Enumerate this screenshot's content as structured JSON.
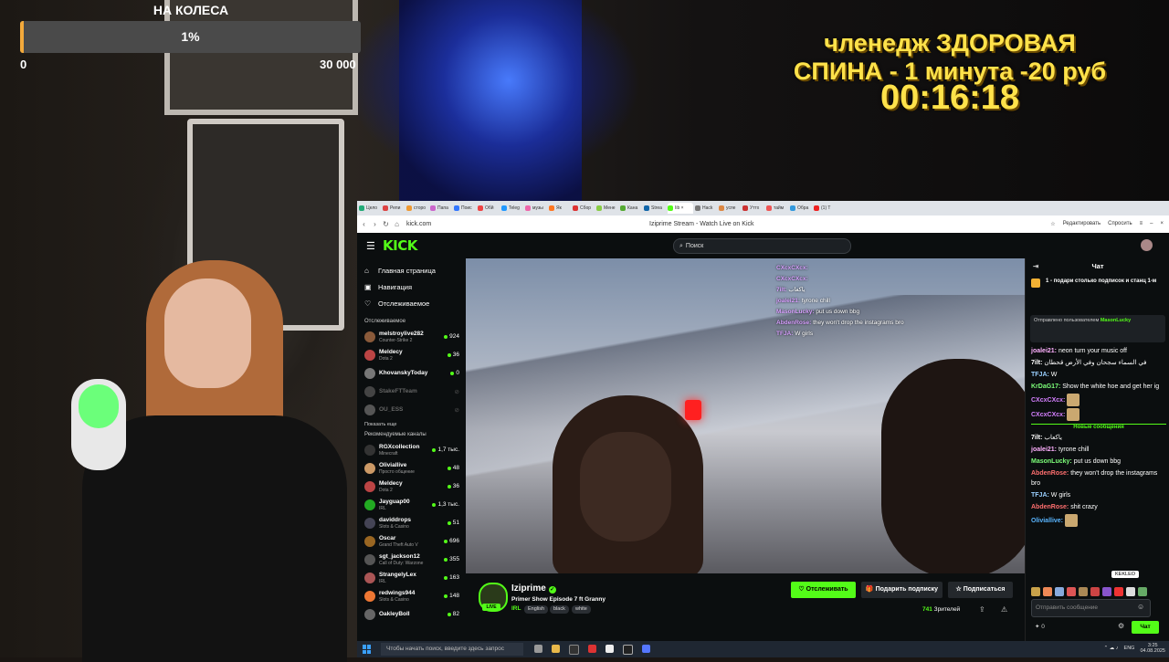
{
  "overlay": {
    "goal_title": "НА КОЛЕСА",
    "goal_percent": "1%",
    "goal_fraction": 0.01,
    "goal_min": "0",
    "goal_max": "30 000",
    "challenge_line1": "членедж ЗДОРОВАЯ",
    "challenge_line2": "СПИНА - 1 минута -20 руб",
    "timer": "00:16:18"
  },
  "browser": {
    "tabs": [
      "Цело",
      "Репи",
      "сторо",
      "Папа",
      "Поис",
      "Обй",
      "Teleg",
      "музы",
      "Як",
      "Сбор",
      "Мене",
      "Кана",
      "Strea",
      "Iib ×",
      "Hack",
      "успе",
      "Уттх",
      "тайм",
      "Обра",
      "(1) T"
    ],
    "active_tab_index": 13,
    "url": "kick.com",
    "page_title": "Iziprime Stream - Watch Live on Kick",
    "right_actions": [
      "Редактировать",
      "Спросить"
    ]
  },
  "kick": {
    "logo": "KICK",
    "search_placeholder": "Поиск",
    "nav": [
      {
        "label": "Главная страница",
        "icon": "home-icon",
        "glyph": "⌂"
      },
      {
        "label": "Навигация",
        "icon": "compass-icon",
        "glyph": "▣"
      },
      {
        "label": "Отслеживаемое",
        "icon": "heart-icon",
        "glyph": "♡"
      }
    ],
    "followed_title": "Отслеживаемое",
    "followed": [
      {
        "name": "melstroylive282",
        "game": "Counter-Strike 2",
        "viewers": "924",
        "online": true,
        "color": "#8a5a3a"
      },
      {
        "name": "Meldecy",
        "game": "Dota 2",
        "viewers": "36",
        "online": true,
        "color": "#b44"
      },
      {
        "name": "KhovanskyToday",
        "game": "",
        "viewers": "0",
        "online": true,
        "color": "#777"
      },
      {
        "name": "StakeFTTeam",
        "game": "",
        "viewers": "",
        "online": false,
        "color": "#444"
      },
      {
        "name": "OU_ESS",
        "game": "",
        "viewers": "",
        "online": false,
        "color": "#555"
      }
    ],
    "show_more": "Показать еще",
    "recommended_title": "Рекомендуемые каналы",
    "recommended": [
      {
        "name": "RGXcollection",
        "game": "Minecraft",
        "viewers": "1,7 тыс.",
        "color": "#333"
      },
      {
        "name": "Oliviallive",
        "game": "Просто общение",
        "viewers": "48",
        "color": "#c96"
      },
      {
        "name": "Meldecy",
        "game": "Dota 2",
        "viewers": "36",
        "color": "#b44"
      },
      {
        "name": "Jayguap00",
        "game": "IRL",
        "viewers": "1,3 тыс.",
        "color": "#2a2"
      },
      {
        "name": "daviddrops",
        "game": "Slots & Casino",
        "viewers": "51",
        "color": "#445"
      },
      {
        "name": "Oscar",
        "game": "Grand Theft Auto V",
        "viewers": "696",
        "color": "#962"
      },
      {
        "name": "sgt_jackson12",
        "game": "Call of Duty: Warzone",
        "viewers": "355",
        "color": "#555"
      },
      {
        "name": "StrangelyLex",
        "game": "IRL",
        "viewers": "163",
        "color": "#a55"
      },
      {
        "name": "redwings944",
        "game": "Slots & Casino",
        "viewers": "148",
        "color": "#e73"
      },
      {
        "name": "OakleyBoll",
        "game": "",
        "viewers": "82",
        "color": "#666"
      }
    ],
    "video_overlay_chat": [
      {
        "user": "CXcxCXcx:",
        "text": ""
      },
      {
        "user": "CXcxCXcx:",
        "text": ""
      },
      {
        "user": "7ilt:",
        "text": "ياكعاب"
      },
      {
        "user": "joalei21:",
        "text": "tyrone chill"
      },
      {
        "user": "MasonLucky:",
        "text": "put us down bbg"
      },
      {
        "user": "AbdenRose:",
        "text": "they won't drop the instagrams bro"
      },
      {
        "user": "TFJA:",
        "text": "W girls"
      }
    ],
    "stream": {
      "streamer": "Iziprime",
      "title": "Primer Show Episode 7 ft Granny",
      "category": "IRL",
      "tags": [
        "English",
        "black",
        "white"
      ],
      "live_label": "LIVE",
      "follow_label": "Отслеживать",
      "gift_label": "Подарить подписку",
      "subscribe_label": "Подписаться",
      "viewers": "741",
      "viewers_suffix": "Зрителей"
    },
    "chat": {
      "title": "Чат",
      "pinned": "1 - подари столько подписок и станц 1-м",
      "gift_banner_prefix": "Отправлено пользователем",
      "gift_banner_user": "MasonLucky",
      "new_messages_label": "Новые сообщения",
      "messages_before": [
        {
          "user": "joalei21:",
          "text": "neon turn your music off",
          "color": "#ffb0ff"
        },
        {
          "user": "7ilt:",
          "text": "في السماء سجحان وفي الأرض قحطان",
          "color": "#ffffff"
        },
        {
          "user": "TFJA:",
          "text": "W",
          "color": "#9ad0ff"
        },
        {
          "user": "KrDaG17:",
          "text": "Show the white hoe and get her ig",
          "color": "#7dff7a"
        },
        {
          "user": "CXcxCXcx:",
          "text": "",
          "color": "#d580ff"
        },
        {
          "user": "CXcxCXcx:",
          "text": "",
          "color": "#d580ff"
        }
      ],
      "messages_after": [
        {
          "user": "7ilt:",
          "text": "ياكعاب",
          "color": "#ffffff"
        },
        {
          "user": "joalei21:",
          "text": "tyrone chill",
          "color": "#ffb0ff"
        },
        {
          "user": "MasonLucky:",
          "text": "put us down bbg",
          "color": "#7dff7a"
        },
        {
          "user": "AbdenRose:",
          "text": "they won't drop the instagrams bro",
          "color": "#ff6f6f"
        },
        {
          "user": "TFJA:",
          "text": "W girls",
          "color": "#9ad0ff"
        },
        {
          "user": "AbdenRose:",
          "text": "shit crazy",
          "color": "#ff6f6f"
        },
        {
          "user": "Oliviallive:",
          "text": "",
          "color": "#59b5ff"
        }
      ],
      "tooltip": "KEKLEO",
      "input_placeholder": "Отправить сообщение",
      "points": "0",
      "send_label": "Чат"
    }
  },
  "taskbar": {
    "search_placeholder": "Чтобы начать поиск, введите здесь запрос",
    "lang": "ENG",
    "time": "3:25",
    "date": "04.08.2025"
  },
  "colors": {
    "kick_green": "#53fc18",
    "overlay_yellow": "#ffe24a",
    "goal_fill": "#f2a93b"
  }
}
